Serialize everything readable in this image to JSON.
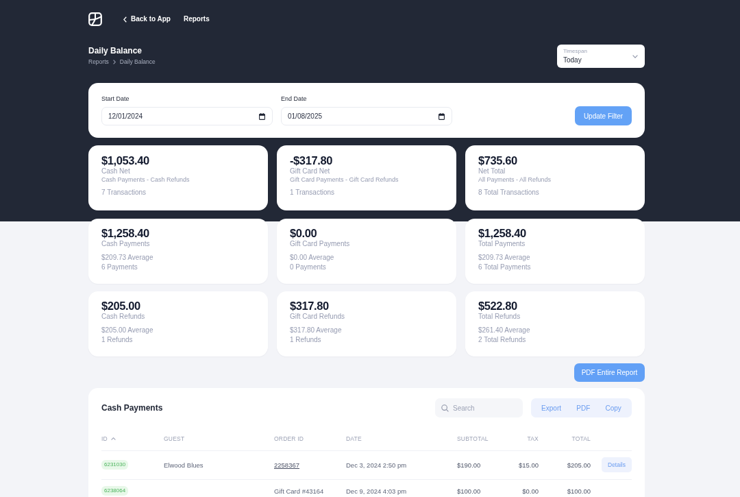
{
  "nav": {
    "back_link": "Back to App",
    "links": [
      {
        "label": "Reports"
      }
    ]
  },
  "page": {
    "title": "Daily Balance",
    "breadcrumb": [
      {
        "label": "Reports"
      },
      {
        "label": "Daily Balance"
      }
    ]
  },
  "timespan": {
    "label": "Timespan",
    "value": "Today"
  },
  "filter": {
    "fields": [
      {
        "label": "Start Date",
        "value": "12/01/2024"
      },
      {
        "label": "End Date",
        "value": "01/08/2025"
      }
    ],
    "button": "Update Filter"
  },
  "summary_cards": [
    {
      "kind": "net",
      "amount": "$1,053.40",
      "label": "Cash Net",
      "formula": "Cash Payments - Cash Refunds",
      "count": "7 Transactions"
    },
    {
      "kind": "net",
      "amount": "-$317.80",
      "label": "Gift Card Net",
      "formula": "Gift Card Payments - Gift Card Refunds",
      "count": "1 Transactions"
    },
    {
      "kind": "net",
      "amount": "$735.60",
      "label": "Net Total",
      "formula": "All Payments - All Refunds",
      "count": "8 Total Transactions"
    },
    {
      "kind": "total",
      "amount": "$1,258.40",
      "label": "Cash Payments",
      "average": "$209.73 Average",
      "count": "6 Payments"
    },
    {
      "kind": "total",
      "amount": "$0.00",
      "label": "Gift Card Payments",
      "average": "$0.00 Average",
      "count": "0 Payments"
    },
    {
      "kind": "total",
      "amount": "$1,258.40",
      "label": "Total Payments",
      "average": "$209.73 Average",
      "count": "6 Total Payments"
    },
    {
      "kind": "total",
      "amount": "$205.00",
      "label": "Cash Refunds",
      "average": "$205.00 Average",
      "count": "1 Refunds"
    },
    {
      "kind": "total",
      "amount": "$317.80",
      "label": "Gift Card Refunds",
      "average": "$317.80 Average",
      "count": "1 Refunds"
    },
    {
      "kind": "total",
      "amount": "$522.80",
      "label": "Total Refunds",
      "average": "$261.40 Average",
      "count": "2 Total Refunds"
    }
  ],
  "report_button": "PDF Entire Report",
  "table": {
    "title": "Cash Payments",
    "search": {
      "placeholder": "Search"
    },
    "actions": [
      "Export",
      "PDF",
      "Copy"
    ],
    "columns": [
      {
        "label": "ID",
        "sorted": true
      },
      {
        "label": "GUEST",
        "sorted": false
      },
      {
        "label": "ORDER ID",
        "sorted": false
      },
      {
        "label": "DATE",
        "sorted": false
      },
      {
        "label": "SUBTOTAL",
        "sorted": false
      },
      {
        "label": "TAX",
        "sorted": false
      },
      {
        "label": "TOTAL",
        "sorted": false
      }
    ],
    "rows": [
      {
        "id": "6231030",
        "guest": "Elwood Blues",
        "order_id": "2258367",
        "order_link": true,
        "date": "Dec 3, 2024 2:50 pm",
        "subtotal": "$190.00",
        "tax": "$15.00",
        "total": "$205.00",
        "action": "Details"
      },
      {
        "id": "6238064",
        "order_id": "Gift Card #43164",
        "order_link": false,
        "date": "Dec 9, 2024 4:03 pm",
        "subtotal": "$100.00",
        "tax": "$0.00",
        "total": "$100.00"
      }
    ]
  }
}
